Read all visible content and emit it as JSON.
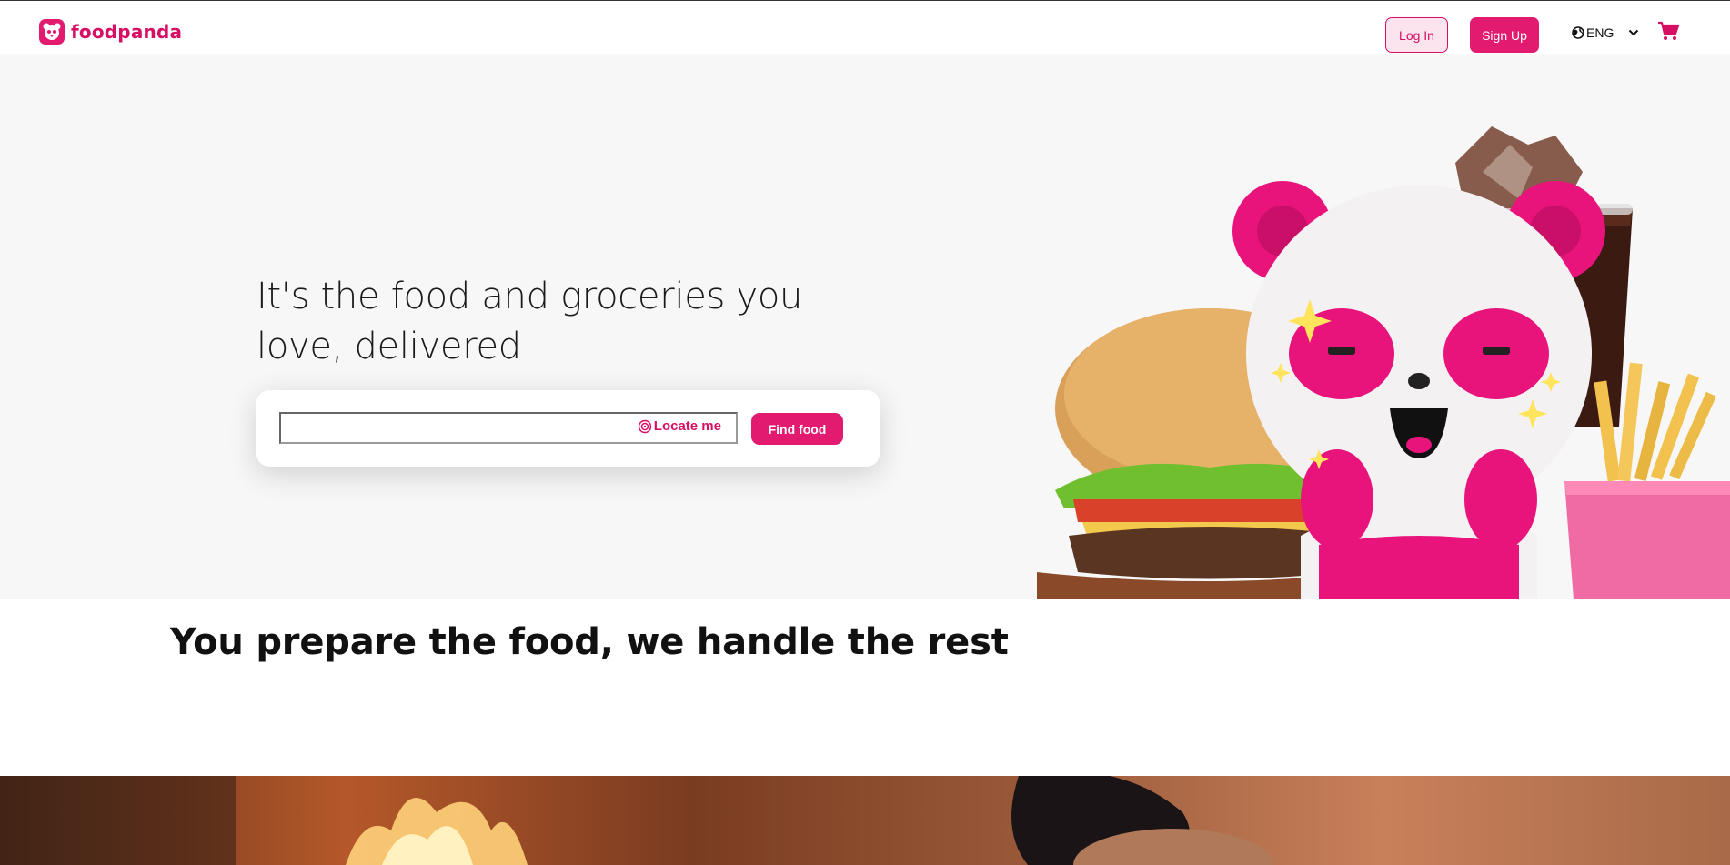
{
  "header": {
    "brand": "foodpanda",
    "login_label": "Log In",
    "signup_label": "Sign Up",
    "language_label": "ENG"
  },
  "hero": {
    "title": "It's the food and groceries you love, delivered",
    "search": {
      "placeholder": "",
      "value": ""
    },
    "locate_label": "Locate me",
    "find_button": "Find food"
  },
  "section": {
    "title": "You prepare the food, we handle the rest"
  },
  "colors": {
    "brand": "#d70f64",
    "brand_button": "#e21b70",
    "hero_bg": "#f7f7f7"
  },
  "icons": {
    "logo": "panda-logo-icon",
    "language": "globe-icon",
    "dropdown": "chevron-down-icon",
    "cart": "shopping-cart-icon",
    "locate": "target-icon"
  }
}
